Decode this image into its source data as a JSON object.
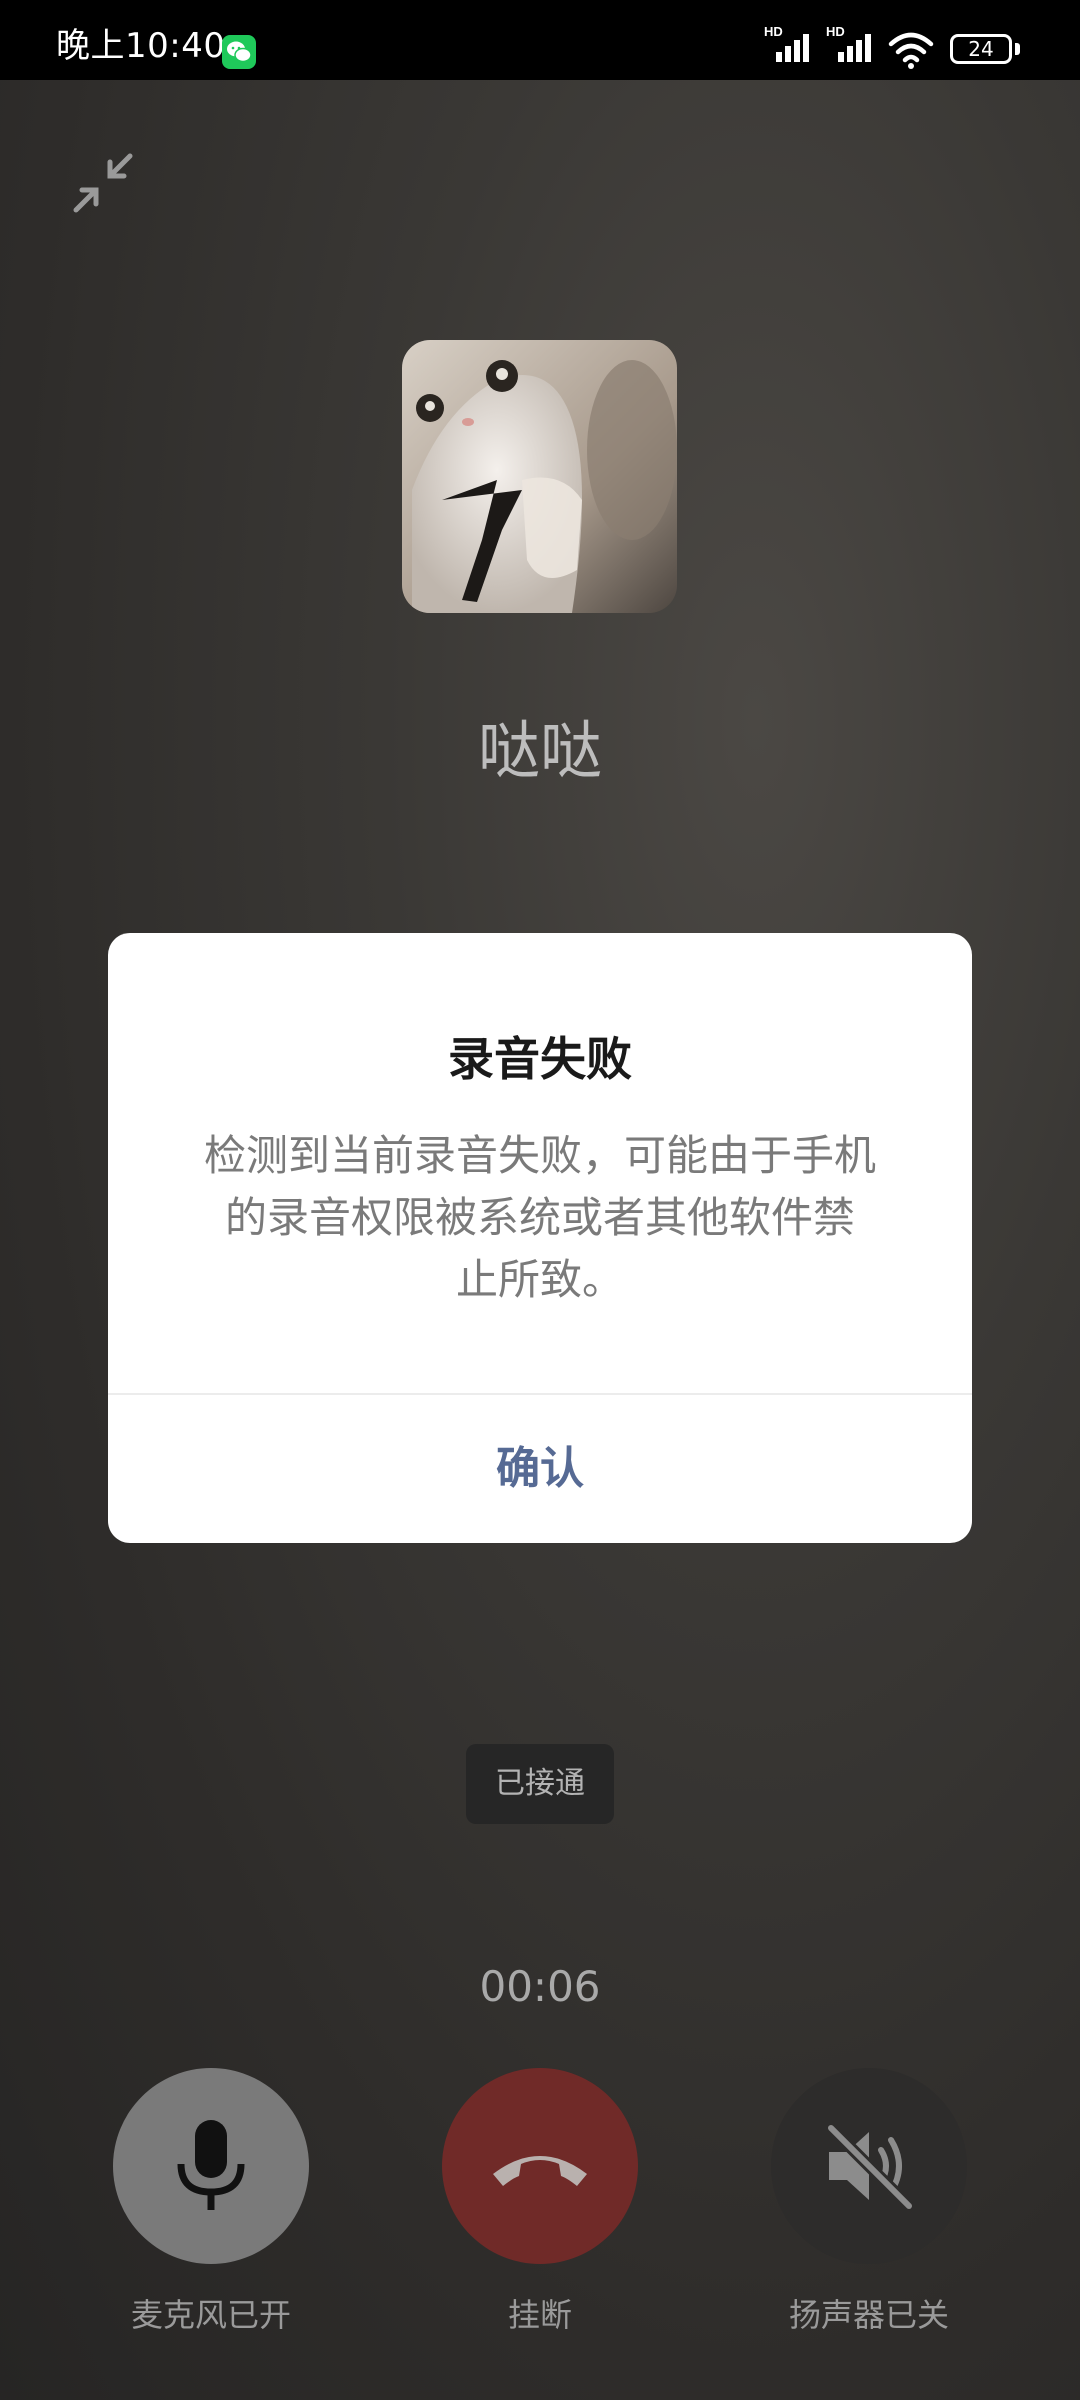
{
  "status_bar": {
    "time": "晚上10:40",
    "battery": "24",
    "network_labels": [
      "HD",
      "HD"
    ]
  },
  "call": {
    "contact_name": "哒哒",
    "status": "已接通",
    "duration": "00:06"
  },
  "dialog": {
    "title": "录音失败",
    "message_lines": [
      "检测到当前录音失败，可能由于手机",
      "的录音权限被系统或者其他软件禁",
      "止所致。"
    ],
    "confirm_label": "确认"
  },
  "controls": {
    "mic_label": "麦克风已开",
    "hangup_label": "挂断",
    "speaker_label": "扬声器已关"
  },
  "colors": {
    "accent": "#566a94",
    "hangup": "#702a28",
    "wechat": "#1fc95a"
  },
  "icons": {
    "app": "wechat-icon",
    "minimize": "minimize-icon",
    "mic": "microphone-icon",
    "hangup": "phone-hangup-icon",
    "speaker": "speaker-muted-icon"
  }
}
